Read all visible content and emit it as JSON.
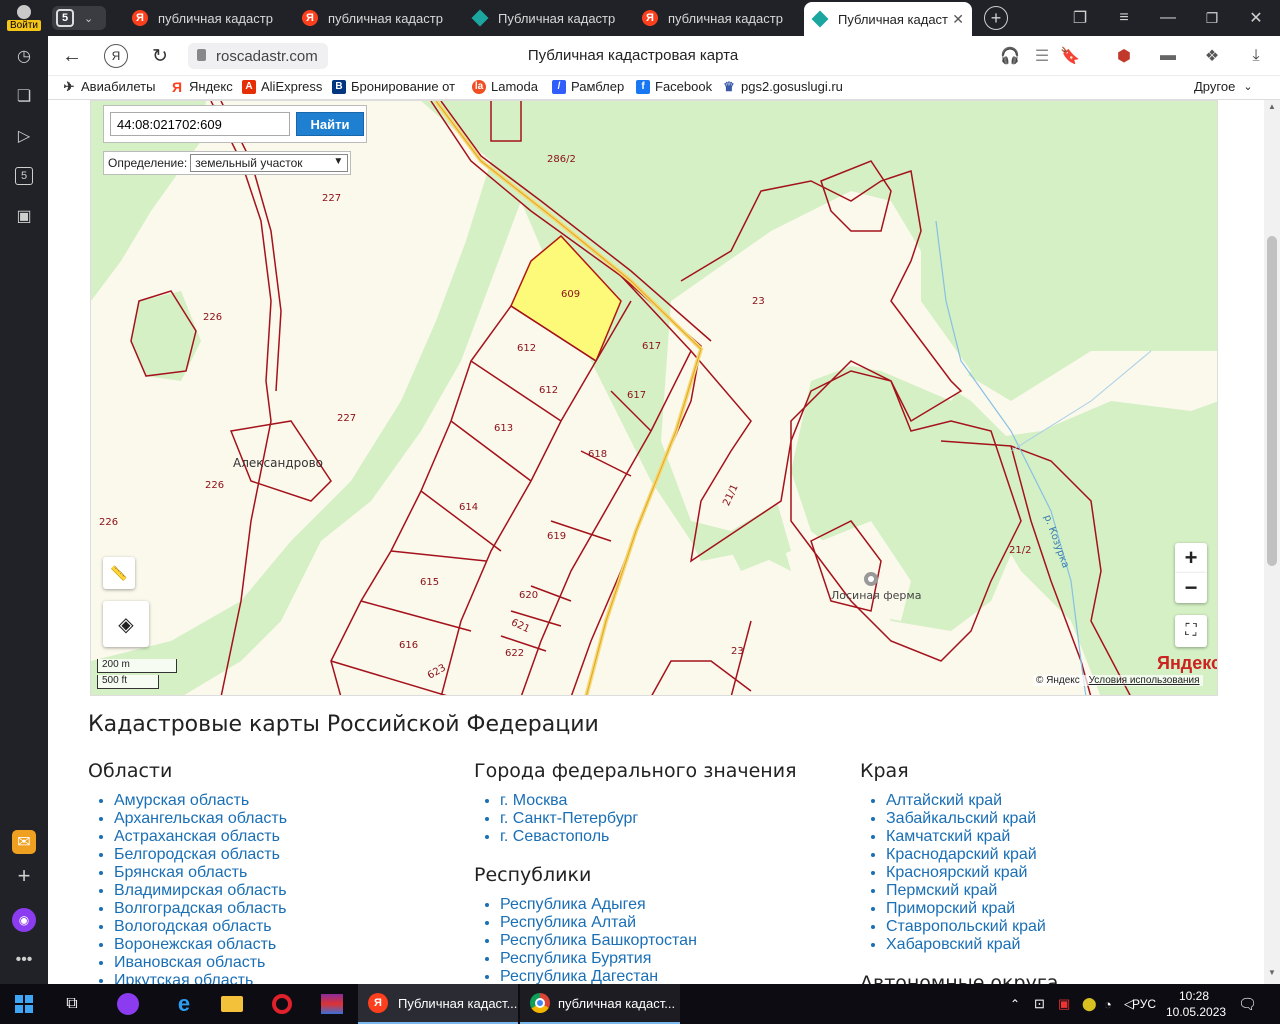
{
  "browser": {
    "profile_label": "Войти",
    "tab_counter": "5",
    "tabs": [
      {
        "title": "публичная кадастр",
        "icon": "yandex"
      },
      {
        "title": "публичная кадастр",
        "icon": "yandex"
      },
      {
        "title": "Публичная кадастр",
        "icon": "pkk"
      },
      {
        "title": "публичная кадастр",
        "icon": "yandex"
      },
      {
        "title": "Публичная кадаст",
        "icon": "pkk",
        "active": true
      }
    ],
    "url": "roscadastr.com",
    "page_title": "Публичная кадастровая карта",
    "bookmarks": [
      "Авиабилеты",
      "Яндекс",
      "AliExpress",
      "Бронирование от",
      "Lamoda",
      "Рамблер",
      "Facebook",
      "pgs2.gosuslugi.ru"
    ],
    "bookmarks_other": "Другое",
    "sidebar_badge": "5"
  },
  "map": {
    "search_value": "44:08:021702:609",
    "search_button": "Найти",
    "definition_label": "Определение:",
    "definition_selected": "земельный участок",
    "village_label": "Александрово",
    "farm_label": "Лосиная ферма",
    "river_label": "р. Козурка",
    "scale_metric": "200 m",
    "scale_imperial": "500 ft",
    "yandex_logo": "Яндекс",
    "copyright": "© Яндекс",
    "terms": "Условия использования",
    "parcels": [
      "286/2",
      "227",
      "226",
      "609",
      "612",
      "612",
      "617",
      "617",
      "23",
      "227",
      "613",
      "618",
      "226",
      "226",
      "614",
      "619",
      "21/1",
      "21/2",
      "615",
      "620",
      "621",
      "616",
      "622",
      "623",
      "23"
    ]
  },
  "content": {
    "heading": "Кадастровые карты Российской Федерации",
    "col1_title": "Области",
    "col1": [
      "Амурская область",
      "Архангельская область",
      "Астраханская область",
      "Белгородская область",
      "Брянская область",
      "Владимирская область",
      "Волгоградская область",
      "Вологодская область",
      "Воронежская область",
      "Ивановская область",
      "Иркутская область"
    ],
    "col2_title": "Города федерального значения",
    "col2": [
      "г. Москва",
      "г. Санкт-Петербург",
      "г. Севастополь"
    ],
    "col2b_title": "Республики",
    "col2b": [
      "Республика Адыгея",
      "Республика Алтай",
      "Республика Башкортостан",
      "Республика Бурятия",
      "Республика Дагестан"
    ],
    "col3_title": "Края",
    "col3": [
      "Алтайский край",
      "Забайкальский край",
      "Камчатский край",
      "Краснодарский край",
      "Красноярский край",
      "Пермский край",
      "Приморский край",
      "Ставропольский край",
      "Хабаровский край"
    ],
    "col3b_title": "Автономные округа"
  },
  "taskbar": {
    "window1": "Публичная кадаст...",
    "window2": "публичная кадаст...",
    "lang": "РУС",
    "time": "10:28",
    "date": "10.05.2023"
  }
}
